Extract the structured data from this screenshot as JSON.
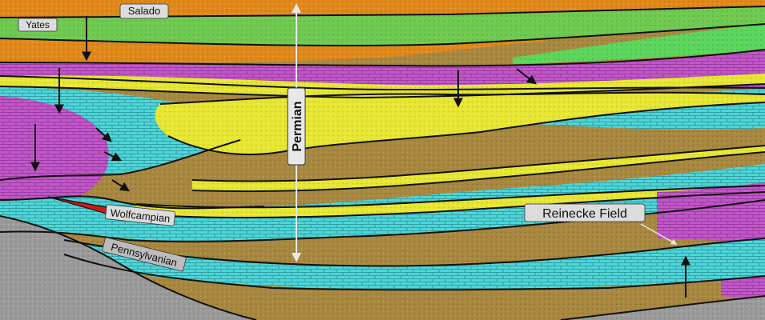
{
  "labels": {
    "salado": "Salado",
    "yates": "Yates",
    "permian": "Permian",
    "wolfcampian": "Wolfcampian",
    "pennsylvanian": "Pennsylvanian",
    "reinecke_field": "Reinecke Field"
  },
  "colors": {
    "salado_orange": "#e0891a",
    "yates_green": "#5cd65c",
    "carbonate_cyan": "#4fd6d8",
    "evaporite_magenta": "#c257c9",
    "sand_yellow": "#e6e633",
    "shale_tan": "#a88840",
    "basement_gray": "#9a9a9a",
    "reef_red": "#d01818",
    "contact_black": "#111111",
    "label_fill": "#dcdcdc"
  },
  "icons": {
    "subsidence_arrow": "down-arrow-icon",
    "flow_arrow": "arrowhead-icon",
    "uplift_arrow": "up-arrow-icon"
  }
}
